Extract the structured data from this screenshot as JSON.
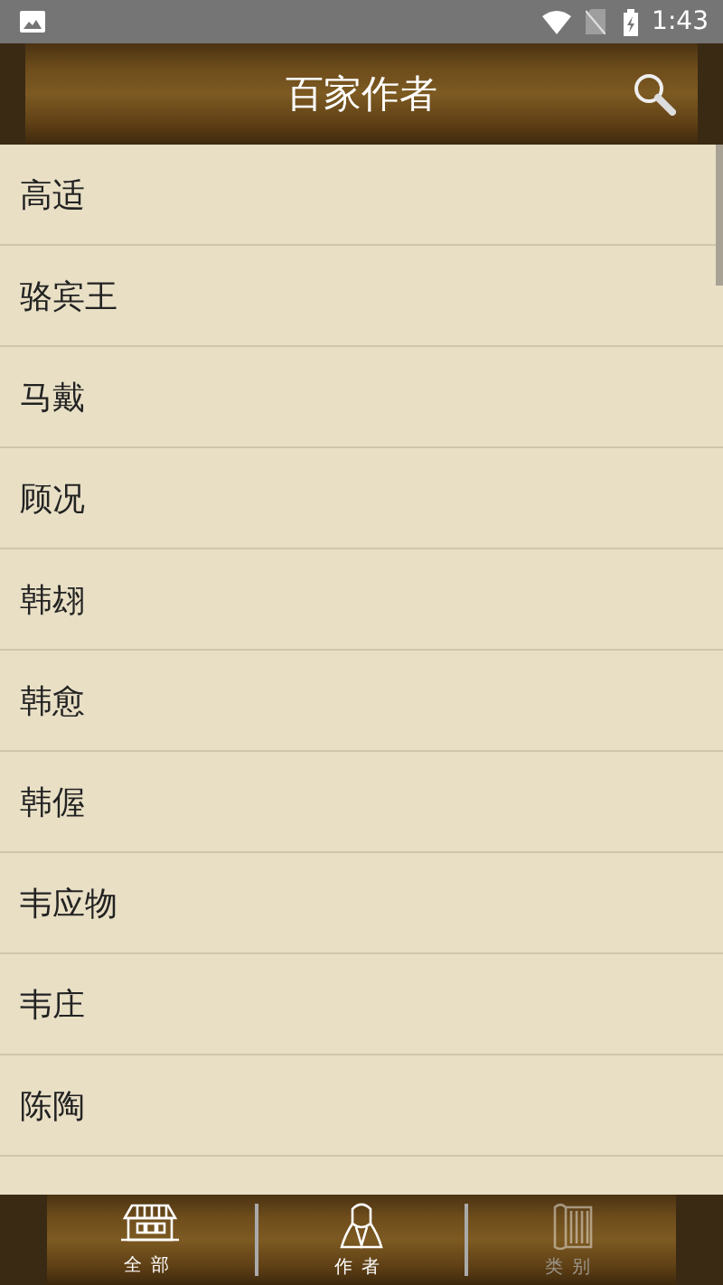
{
  "status_bar": {
    "time": "1:43"
  },
  "header": {
    "title": "百家作者"
  },
  "authors": [
    "高适",
    "骆宾王",
    "马戴",
    "顾况",
    "韩翃",
    "韩愈",
    "韩偓",
    "韦应物",
    "韦庄",
    "陈陶"
  ],
  "bottom_tabs": [
    {
      "label": "全部",
      "kind": "house",
      "dimmed": false
    },
    {
      "label": "作者",
      "kind": "person",
      "dimmed": false
    },
    {
      "label": "类别",
      "kind": "scroll",
      "dimmed": true
    }
  ]
}
